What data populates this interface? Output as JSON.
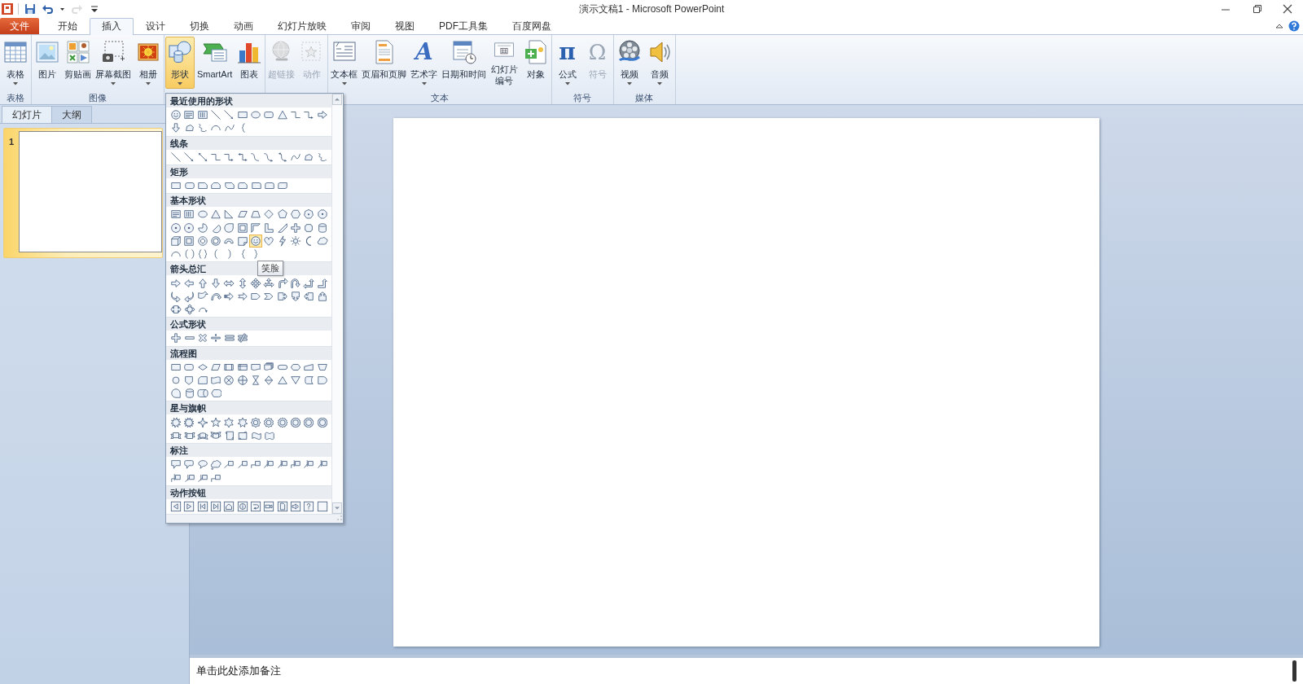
{
  "window": {
    "title": "演示文稿1 - Microsoft PowerPoint"
  },
  "quick_access": [
    {
      "kind": "save",
      "disabled": false
    },
    {
      "kind": "undo",
      "disabled": false
    },
    {
      "kind": "redo",
      "disabled": true
    },
    {
      "kind": "customize",
      "disabled": false
    }
  ],
  "ribbon_tabs": [
    {
      "label": "文件",
      "kind": "file",
      "selected": false
    },
    {
      "label": "开始",
      "kind": "tab",
      "selected": false
    },
    {
      "label": "插入",
      "kind": "tab",
      "selected": true
    },
    {
      "label": "设计",
      "kind": "tab",
      "selected": false
    },
    {
      "label": "切换",
      "kind": "tab",
      "selected": false
    },
    {
      "label": "动画",
      "kind": "tab",
      "selected": false
    },
    {
      "label": "幻灯片放映",
      "kind": "tab",
      "selected": false
    },
    {
      "label": "审阅",
      "kind": "tab",
      "selected": false
    },
    {
      "label": "视图",
      "kind": "tab",
      "selected": false
    },
    {
      "label": "PDF工具集",
      "kind": "tab",
      "selected": false
    },
    {
      "label": "百度网盘",
      "kind": "tab",
      "selected": false
    }
  ],
  "ribbon_groups": [
    {
      "label": "表格",
      "buttons": [
        {
          "kind": "table",
          "label": "表格",
          "dropdown": true,
          "disabled": false,
          "pressed": false
        }
      ]
    },
    {
      "label": "图像",
      "buttons": [
        {
          "kind": "picture",
          "label": "图片",
          "dropdown": false,
          "disabled": false,
          "pressed": false
        },
        {
          "kind": "clipart",
          "label": "剪贴画",
          "dropdown": false,
          "disabled": false,
          "pressed": false
        },
        {
          "kind": "screenshot",
          "label": "屏幕截图",
          "dropdown": true,
          "disabled": false,
          "pressed": false
        },
        {
          "kind": "album",
          "label": "相册",
          "dropdown": true,
          "disabled": false,
          "pressed": false
        }
      ]
    },
    {
      "buttons": [
        {
          "kind": "shapes",
          "label": "形状",
          "dropdown": true,
          "disabled": false,
          "pressed": true
        },
        {
          "kind": "smartart",
          "label": "SmartArt",
          "dropdown": false,
          "disabled": false,
          "pressed": false
        },
        {
          "kind": "chart",
          "label": "图表",
          "dropdown": false,
          "disabled": false,
          "pressed": false
        }
      ]
    },
    {
      "buttons": [
        {
          "kind": "hyperlink",
          "label": "超链接",
          "dropdown": false,
          "disabled": true,
          "pressed": false
        },
        {
          "kind": "action",
          "label": "动作",
          "dropdown": false,
          "disabled": true,
          "pressed": false
        }
      ]
    },
    {
      "label": "文本",
      "buttons": [
        {
          "kind": "textbox",
          "label": "文本框",
          "dropdown": true,
          "disabled": false,
          "pressed": false
        },
        {
          "kind": "header-footer",
          "label": "页眉和页脚",
          "dropdown": false,
          "disabled": false,
          "pressed": false
        },
        {
          "kind": "wordart",
          "icon_char": "A",
          "label": "艺术字",
          "dropdown": true,
          "disabled": false,
          "pressed": false
        },
        {
          "kind": "datetime",
          "label": "日期和时间",
          "dropdown": false,
          "disabled": false,
          "pressed": false
        },
        {
          "kind": "slide-number",
          "label": "幻灯片编号",
          "dropdown": false,
          "disabled": false,
          "pressed": false
        },
        {
          "kind": "object",
          "label": "对象",
          "dropdown": false,
          "disabled": false,
          "pressed": false
        }
      ]
    },
    {
      "label": "符号",
      "buttons": [
        {
          "kind": "equation",
          "icon_char": "π",
          "label": "公式",
          "dropdown": true,
          "disabled": false,
          "pressed": false
        },
        {
          "kind": "symbol",
          "icon_char": "Ω",
          "label": "符号",
          "dropdown": false,
          "disabled": true,
          "pressed": false
        }
      ]
    },
    {
      "label": "媒体",
      "buttons": [
        {
          "kind": "video",
          "label": "视频",
          "dropdown": true,
          "disabled": false,
          "pressed": false
        },
        {
          "kind": "audio",
          "label": "音频",
          "dropdown": true,
          "disabled": false,
          "pressed": false
        }
      ]
    }
  ],
  "shapes_menu": {
    "tooltip": "笑脸",
    "sections": [
      {
        "title": "最近使用的形状",
        "shapes": [
          {
            "kind": "smiley",
            "selected": false
          },
          {
            "kind": "textbox",
            "selected": false
          },
          {
            "kind": "vtextbox",
            "selected": false
          },
          {
            "kind": "line",
            "selected": false
          },
          {
            "kind": "arrow-line",
            "selected": false
          },
          {
            "kind": "rect",
            "selected": false
          },
          {
            "kind": "ellipse",
            "selected": false
          },
          {
            "kind": "rounded",
            "selected": false
          },
          {
            "kind": "triangle",
            "selected": false
          },
          {
            "kind": "elbow",
            "selected": false
          },
          {
            "kind": "elbow-arrow",
            "selected": false
          },
          {
            "kind": "arrow-right",
            "selected": false
          },
          {
            "kind": "arrow-down",
            "selected": false
          },
          {
            "kind": "freeform",
            "selected": false
          },
          {
            "kind": "scribble",
            "selected": false
          },
          {
            "kind": "arc",
            "selected": false
          },
          {
            "kind": "curve",
            "selected": false
          },
          {
            "kind": "brace-left",
            "selected": false
          }
        ]
      },
      {
        "title": "线条",
        "shapes": [
          {
            "kind": "line",
            "selected": false
          },
          {
            "kind": "arrow-line",
            "selected": false
          },
          {
            "kind": "double-arrow-line",
            "selected": false
          },
          {
            "kind": "elbow",
            "selected": false
          },
          {
            "kind": "elbow-arrow",
            "selected": false
          },
          {
            "kind": "elbow-double-arrow",
            "selected": false
          },
          {
            "kind": "curve-connector",
            "selected": false
          },
          {
            "kind": "curve-arrow",
            "selected": false
          },
          {
            "kind": "curve-double-arrow",
            "selected": false
          },
          {
            "kind": "curve",
            "selected": false
          },
          {
            "kind": "freeform",
            "selected": false
          },
          {
            "kind": "scribble",
            "selected": false
          }
        ]
      },
      {
        "title": "矩形",
        "shapes": [
          {
            "kind": "rect",
            "selected": false
          },
          {
            "kind": "rounded",
            "selected": false
          },
          {
            "kind": "snip-one",
            "selected": false
          },
          {
            "kind": "snip-same",
            "selected": false
          },
          {
            "kind": "snip-diag",
            "selected": false
          },
          {
            "kind": "snip-round",
            "selected": false
          },
          {
            "kind": "round-one",
            "selected": false
          },
          {
            "kind": "round-same",
            "selected": false
          },
          {
            "kind": "round-diag",
            "selected": false
          }
        ]
      },
      {
        "title": "基本形状",
        "shapes": [
          {
            "kind": "textbox",
            "selected": false
          },
          {
            "kind": "vtextbox",
            "selected": false
          },
          {
            "kind": "ellipse",
            "selected": false
          },
          {
            "kind": "triangle",
            "selected": false
          },
          {
            "kind": "right-triangle",
            "selected": false
          },
          {
            "kind": "parallelogram",
            "selected": false
          },
          {
            "kind": "trapezoid",
            "selected": false
          },
          {
            "kind": "diamond",
            "selected": false
          },
          {
            "kind": "pentagon",
            "selected": false
          },
          {
            "kind": "hexagon",
            "selected": false
          },
          {
            "kind": "heptagon",
            "selected": false
          },
          {
            "kind": "octagon",
            "selected": false
          },
          {
            "kind": "decagon",
            "selected": false
          },
          {
            "kind": "dodecagon",
            "selected": false
          },
          {
            "kind": "pie",
            "selected": false
          },
          {
            "kind": "chord",
            "selected": false
          },
          {
            "kind": "teardrop",
            "selected": false
          },
          {
            "kind": "frame",
            "selected": false
          },
          {
            "kind": "half-frame",
            "selected": false
          },
          {
            "kind": "l-shape",
            "selected": false
          },
          {
            "kind": "stripe",
            "selected": false
          },
          {
            "kind": "cross",
            "selected": false
          },
          {
            "kind": "plaque",
            "selected": false
          },
          {
            "kind": "cylinder",
            "selected": false
          },
          {
            "kind": "cube",
            "selected": false
          },
          {
            "kind": "bevel",
            "selected": false
          },
          {
            "kind": "donut",
            "selected": false
          },
          {
            "kind": "no-symbol",
            "selected": false
          },
          {
            "kind": "block-arc",
            "selected": false
          },
          {
            "kind": "folded",
            "selected": false
          },
          {
            "kind": "smiley",
            "selected": true
          },
          {
            "kind": "heart",
            "selected": false
          },
          {
            "kind": "lightning",
            "selected": false
          },
          {
            "kind": "sun",
            "selected": false
          },
          {
            "kind": "moon",
            "selected": false
          },
          {
            "kind": "cloud",
            "selected": false
          },
          {
            "kind": "arc",
            "selected": false
          },
          {
            "kind": "bracket-pair",
            "selected": false
          },
          {
            "kind": "brace-pair",
            "selected": false
          },
          {
            "kind": "bracket-left",
            "selected": false
          },
          {
            "kind": "bracket-right",
            "selected": false
          },
          {
            "kind": "brace-left",
            "selected": false
          },
          {
            "kind": "brace-right",
            "selected": false
          }
        ]
      },
      {
        "title": "箭头总汇",
        "shapes": [
          {
            "kind": "arrow-right",
            "selected": false
          },
          {
            "kind": "arrow-left",
            "selected": false
          },
          {
            "kind": "arrow-up",
            "selected": false
          },
          {
            "kind": "arrow-down",
            "selected": false
          },
          {
            "kind": "arrow-left-right",
            "selected": false
          },
          {
            "kind": "arrow-up-down",
            "selected": false
          },
          {
            "kind": "arrow-quad",
            "selected": false
          },
          {
            "kind": "arrow-left-right-up",
            "selected": false
          },
          {
            "kind": "arrow-bent",
            "selected": false
          },
          {
            "kind": "arrow-uturn",
            "selected": false
          },
          {
            "kind": "arrow-left-up",
            "selected": false
          },
          {
            "kind": "arrow-bent-up",
            "selected": false
          },
          {
            "kind": "arrow-curved-right",
            "selected": false
          },
          {
            "kind": "arrow-curved-left",
            "selected": false
          },
          {
            "kind": "arrow-curved-up",
            "selected": false
          },
          {
            "kind": "arrow-curved-down",
            "selected": false
          },
          {
            "kind": "arrow-striped",
            "selected": false
          },
          {
            "kind": "arrow-notched",
            "selected": false
          },
          {
            "kind": "arrow-pentagon",
            "selected": false
          },
          {
            "kind": "chevron",
            "selected": false
          },
          {
            "kind": "callout-arrow-right",
            "selected": false
          },
          {
            "kind": "callout-arrow-down",
            "selected": false
          },
          {
            "kind": "callout-arrow-left",
            "selected": false
          },
          {
            "kind": "callout-arrow-up",
            "selected": false
          },
          {
            "kind": "callout-arrow-left-right",
            "selected": false
          },
          {
            "kind": "callout-arrow-quad",
            "selected": false
          },
          {
            "kind": "arrow-circular",
            "selected": false
          }
        ]
      },
      {
        "title": "公式形状",
        "shapes": [
          {
            "kind": "plus",
            "selected": false
          },
          {
            "kind": "minus",
            "selected": false
          },
          {
            "kind": "multiply",
            "selected": false
          },
          {
            "kind": "divide",
            "selected": false
          },
          {
            "kind": "equal",
            "selected": false
          },
          {
            "kind": "not-equal",
            "selected": false
          }
        ]
      },
      {
        "title": "流程图",
        "shapes": [
          {
            "kind": "process",
            "selected": false
          },
          {
            "kind": "alt-process",
            "selected": false
          },
          {
            "kind": "decision",
            "selected": false
          },
          {
            "kind": "data",
            "selected": false
          },
          {
            "kind": "predefined",
            "selected": false
          },
          {
            "kind": "internal-storage",
            "selected": false
          },
          {
            "kind": "document",
            "selected": false
          },
          {
            "kind": "multidocument",
            "selected": false
          },
          {
            "kind": "terminator",
            "selected": false
          },
          {
            "kind": "preparation",
            "selected": false
          },
          {
            "kind": "manual-input",
            "selected": false
          },
          {
            "kind": "manual-operation",
            "selected": false
          },
          {
            "kind": "connector",
            "selected": false
          },
          {
            "kind": "offpage",
            "selected": false
          },
          {
            "kind": "card",
            "selected": false
          },
          {
            "kind": "punched-tape",
            "selected": false
          },
          {
            "kind": "summing",
            "selected": false
          },
          {
            "kind": "or",
            "selected": false
          },
          {
            "kind": "collate",
            "selected": false
          },
          {
            "kind": "sort",
            "selected": false
          },
          {
            "kind": "extract",
            "selected": false
          },
          {
            "kind": "merge",
            "selected": false
          },
          {
            "kind": "stored-data",
            "selected": false
          },
          {
            "kind": "delay",
            "selected": false
          },
          {
            "kind": "sequential-access",
            "selected": false
          },
          {
            "kind": "magnetic-disk",
            "selected": false
          },
          {
            "kind": "direct-access",
            "selected": false
          },
          {
            "kind": "display",
            "selected": false
          }
        ]
      },
      {
        "title": "星与旗帜",
        "shapes": [
          {
            "kind": "explosion",
            "selected": false
          },
          {
            "kind": "explosion-alt",
            "selected": false
          },
          {
            "kind": "star4",
            "selected": false
          },
          {
            "kind": "star5",
            "selected": false
          },
          {
            "kind": "star6",
            "selected": false
          },
          {
            "kind": "star7",
            "selected": false
          },
          {
            "kind": "star8",
            "selected": false
          },
          {
            "kind": "star10",
            "selected": false
          },
          {
            "kind": "star12",
            "selected": false
          },
          {
            "kind": "star16",
            "selected": false
          },
          {
            "kind": "star24",
            "selected": false
          },
          {
            "kind": "star32",
            "selected": false
          },
          {
            "kind": "ribbon-up",
            "selected": false
          },
          {
            "kind": "ribbon-down",
            "selected": false
          },
          {
            "kind": "curved-ribbon-up",
            "selected": false
          },
          {
            "kind": "curved-ribbon-down",
            "selected": false
          },
          {
            "kind": "scroll-vertical",
            "selected": false
          },
          {
            "kind": "scroll-horizontal",
            "selected": false
          },
          {
            "kind": "wave",
            "selected": false
          },
          {
            "kind": "double-wave",
            "selected": false
          }
        ]
      },
      {
        "title": "标注",
        "shapes": [
          {
            "kind": "callout-rect",
            "selected": false
          },
          {
            "kind": "callout-rounded",
            "selected": false
          },
          {
            "kind": "callout-oval",
            "selected": false
          },
          {
            "kind": "callout-cloud",
            "selected": false
          },
          {
            "kind": "line-callout",
            "selected": false
          },
          {
            "kind": "line-callout",
            "selected": false
          },
          {
            "kind": "line-callout-bent",
            "selected": false
          },
          {
            "kind": "line-callout-accent",
            "selected": false
          },
          {
            "kind": "line-callout-accent",
            "selected": false
          },
          {
            "kind": "line-callout-bent-accent",
            "selected": false
          },
          {
            "kind": "line-callout-accent",
            "selected": false
          },
          {
            "kind": "line-callout-accent",
            "selected": false
          },
          {
            "kind": "line-callout-bent-accent",
            "selected": false
          },
          {
            "kind": "line-callout-border",
            "selected": false
          },
          {
            "kind": "line-callout-border",
            "selected": false
          },
          {
            "kind": "line-callout-bent-border",
            "selected": false
          }
        ]
      },
      {
        "title": "动作按钮",
        "shapes": [
          {
            "kind": "action-back",
            "selected": false
          },
          {
            "kind": "action-forward",
            "selected": false
          },
          {
            "kind": "action-begin",
            "selected": false
          },
          {
            "kind": "action-end",
            "selected": false
          },
          {
            "kind": "action-home",
            "selected": false
          },
          {
            "kind": "action-info",
            "selected": false
          },
          {
            "kind": "action-return",
            "selected": false
          },
          {
            "kind": "action-movie",
            "selected": false
          },
          {
            "kind": "action-document",
            "selected": false
          },
          {
            "kind": "action-sound",
            "selected": false
          },
          {
            "kind": "action-help",
            "selected": false
          },
          {
            "kind": "action-blank",
            "selected": false
          }
        ]
      }
    ]
  },
  "slide_pane": {
    "tabs": [
      {
        "label": "幻灯片",
        "selected": true
      },
      {
        "label": "大纲",
        "selected": false
      }
    ],
    "slides": [
      {
        "number": "1",
        "selected": true
      }
    ]
  },
  "notes": {
    "prompt": "单击此处添加备注"
  }
}
